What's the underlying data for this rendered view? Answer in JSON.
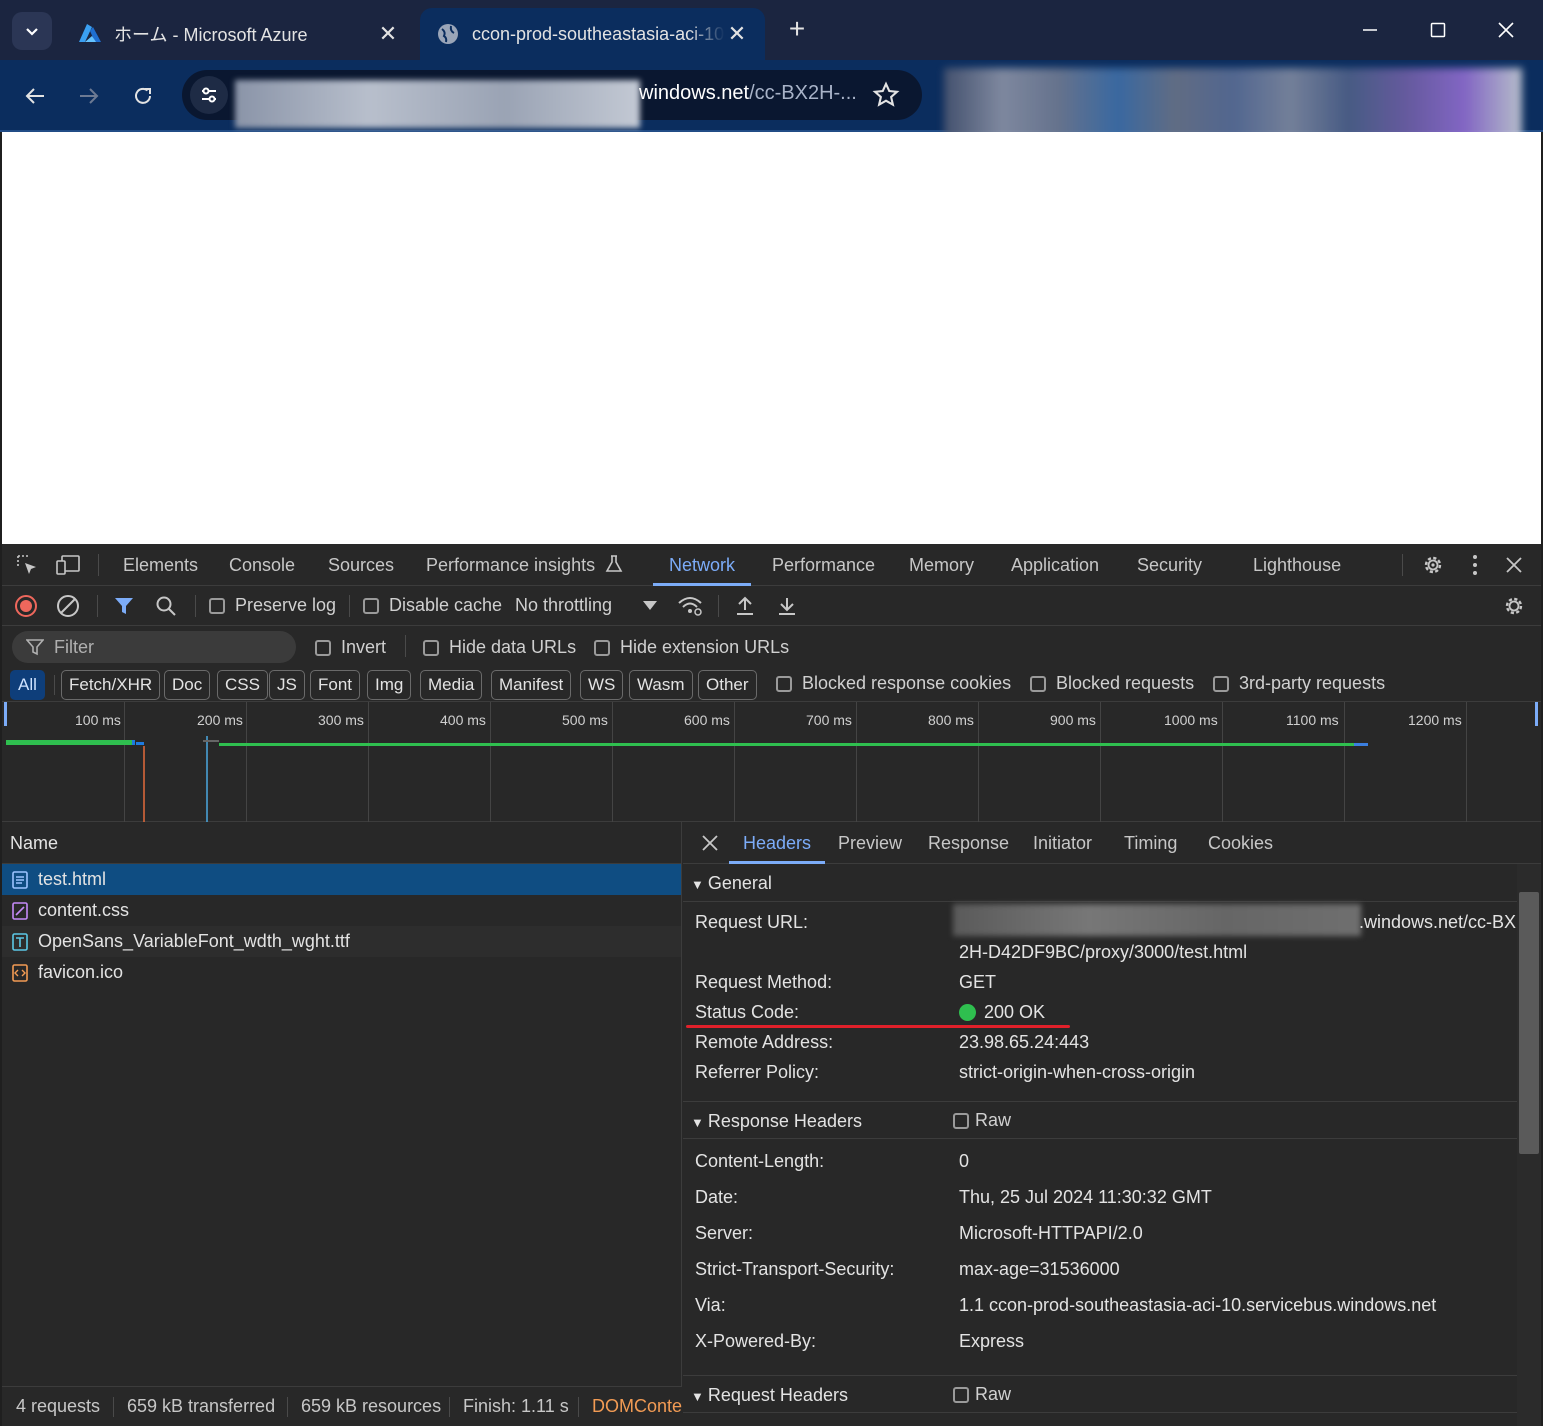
{
  "browser": {
    "tabs": [
      {
        "title": "ホーム - Microsoft Azure"
      },
      {
        "title": "ccon-prod-southeastasia-aci-10"
      }
    ],
    "url_host": "windows.net",
    "url_path": "/cc-BX2H-..."
  },
  "devtools": {
    "panels": [
      "Elements",
      "Console",
      "Sources",
      "Performance insights",
      "Network",
      "Performance",
      "Memory",
      "Application",
      "Security",
      "Lighthouse"
    ],
    "active_panel": "Network",
    "toolbar": {
      "preserve_log": "Preserve log",
      "disable_cache": "Disable cache",
      "throttling": "No throttling"
    },
    "filter": {
      "placeholder": "Filter",
      "invert": "Invert",
      "hide_data_urls": "Hide data URLs",
      "hide_extension_urls": "Hide extension URLs"
    },
    "types": [
      "All",
      "Fetch/XHR",
      "Doc",
      "CSS",
      "JS",
      "Font",
      "Img",
      "Media",
      "Manifest",
      "WS",
      "Wasm",
      "Other"
    ],
    "active_type": "All",
    "type_checks": {
      "blocked_cookies": "Blocked response cookies",
      "blocked_requests": "Blocked requests",
      "third_party": "3rd-party requests"
    },
    "timeline_ticks": [
      "100 ms",
      "200 ms",
      "300 ms",
      "400 ms",
      "500 ms",
      "600 ms",
      "700 ms",
      "800 ms",
      "900 ms",
      "1000 ms",
      "1100 ms",
      "1200 ms"
    ],
    "requests": {
      "column": "Name",
      "files": [
        {
          "name": "test.html",
          "type": "doc"
        },
        {
          "name": "content.css",
          "type": "css"
        },
        {
          "name": "OpenSans_VariableFont_wdth_wght.ttf",
          "type": "font"
        },
        {
          "name": "favicon.ico",
          "type": "img"
        }
      ]
    },
    "detail": {
      "tabs": [
        "Headers",
        "Preview",
        "Response",
        "Initiator",
        "Timing",
        "Cookies"
      ],
      "active_tab": "Headers",
      "general": {
        "title": "General",
        "request_url_label": "Request URL:",
        "request_url_line1": ".windows.net/cc-BX",
        "request_url_line2": "2H-D42DF9BC/proxy/3000/test.html",
        "request_method_label": "Request Method:",
        "request_method": "GET",
        "status_code_label": "Status Code:",
        "status_code": "200 OK",
        "remote_address_label": "Remote Address:",
        "remote_address": "23.98.65.24:443",
        "referrer_policy_label": "Referrer Policy:",
        "referrer_policy": "strict-origin-when-cross-origin"
      },
      "response_headers": {
        "title": "Response Headers",
        "raw": "Raw",
        "items": [
          {
            "k": "Content-Length:",
            "v": "0"
          },
          {
            "k": "Date:",
            "v": "Thu, 25 Jul 2024 11:30:32 GMT"
          },
          {
            "k": "Server:",
            "v": "Microsoft-HTTPAPI/2.0"
          },
          {
            "k": "Strict-Transport-Security:",
            "v": "max-age=31536000"
          },
          {
            "k": "Via:",
            "v": "1.1 ccon-prod-southeastasia-aci-10.servicebus.windows.net"
          },
          {
            "k": "X-Powered-By:",
            "v": "Express"
          }
        ]
      },
      "request_headers": {
        "title": "Request Headers",
        "raw": "Raw"
      }
    },
    "status": {
      "requests": "4 requests",
      "transferred": "659 kB transferred",
      "resources": "659 kB resources",
      "finish": "Finish: 1.11 s",
      "domcontent": "DOMConte"
    }
  },
  "colors": {
    "accent": "#7cacf8",
    "status_ok": "#2fbf4f",
    "annotation": "#e0202a"
  }
}
